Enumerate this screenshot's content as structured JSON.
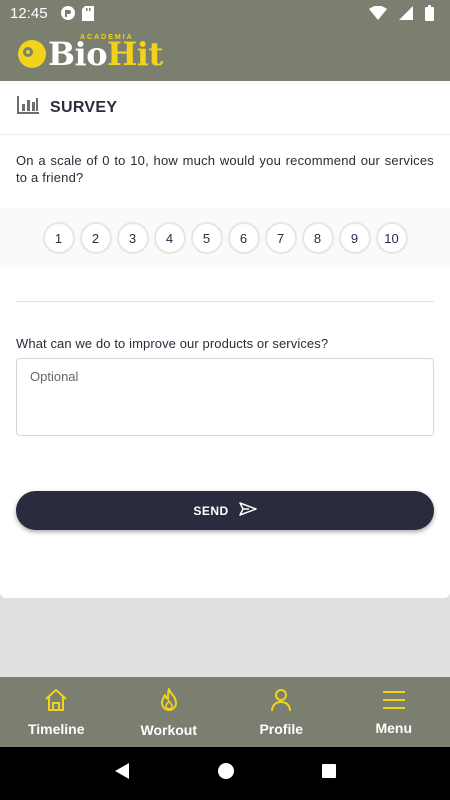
{
  "status_bar": {
    "time": "12:45",
    "icons": [
      "notification-icon",
      "sd-card-icon"
    ],
    "right_icons": [
      "wifi-icon",
      "signal-icon",
      "battery-icon"
    ]
  },
  "header": {
    "logo_text_bio": "Bio",
    "logo_text_hit": "Hit",
    "logo_subtext": "ACADEMIA"
  },
  "survey": {
    "icon": "bar-chart-icon",
    "title": "SURVEY",
    "question1": "On a scale of 0 to 10, how much would you recommend our services to a friend?",
    "scale": [
      "1",
      "2",
      "3",
      "4",
      "5",
      "6",
      "7",
      "8",
      "9",
      "10"
    ],
    "question2": "What can we do to improve our products or services?",
    "feedback_placeholder": "Optional",
    "feedback_value": "",
    "send_label": "SEND",
    "send_icon": "send-icon"
  },
  "bottom_nav": {
    "items": [
      {
        "label": "Timeline",
        "icon": "home-icon"
      },
      {
        "label": "Workout",
        "icon": "flame-icon"
      },
      {
        "label": "Profile",
        "icon": "person-icon"
      },
      {
        "label": "Menu",
        "icon": "menu-icon"
      }
    ]
  },
  "colors": {
    "header_bg": "#7a7f70",
    "accent": "#f2d31b",
    "button_dark": "#292b3e"
  }
}
